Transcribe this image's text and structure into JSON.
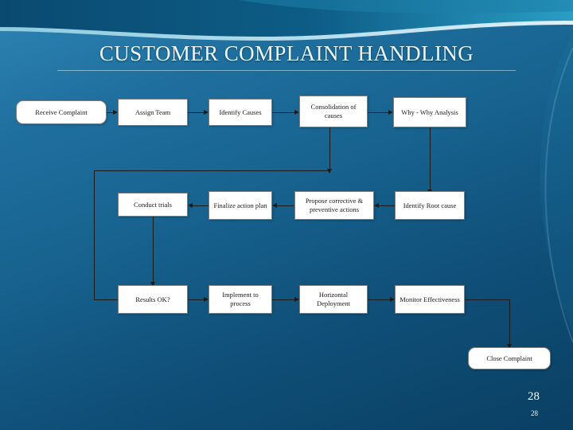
{
  "slide": {
    "title": "CUSTOMER COMPLAINT HANDLING",
    "page_number": "28",
    "page_number_small": "28",
    "colors": {
      "background_top": "#2e85b4",
      "background_bottom": "#0a3f63",
      "node_fill": "#ffffff",
      "node_border": "#7e7e7e",
      "connector": "#1b1b1b",
      "title_text": "#eaf6fb"
    }
  },
  "diagram": {
    "type": "flowchart",
    "nodes": [
      {
        "id": "receive-complaint",
        "label": "Receive Complaint",
        "shape": "rounded",
        "row": 1,
        "col": 1
      },
      {
        "id": "assign-team",
        "label": "Assign Team",
        "shape": "rect",
        "row": 1,
        "col": 2
      },
      {
        "id": "identify-causes",
        "label": "Identify Causes",
        "shape": "rect",
        "row": 1,
        "col": 3
      },
      {
        "id": "consolidation-of-causes",
        "label": "Consolidation of causes",
        "shape": "rect",
        "row": 1,
        "col": 4
      },
      {
        "id": "why-why-analysis",
        "label": "Why - Why Analysis",
        "shape": "rect",
        "row": 1,
        "col": 5
      },
      {
        "id": "conduct-trials",
        "label": "Conduct trials",
        "shape": "rect",
        "row": 2,
        "col": 2
      },
      {
        "id": "finalize-action-plan",
        "label": "Finalize action plan",
        "shape": "rect",
        "row": 2,
        "col": 3
      },
      {
        "id": "propose-corrective-preventive-actions",
        "label": "Propose corrective & preventive actions",
        "shape": "rect",
        "row": 2,
        "col": 4
      },
      {
        "id": "identify-root-cause",
        "label": "Identify Root cause",
        "shape": "rect",
        "row": 2,
        "col": 5
      },
      {
        "id": "results-ok",
        "label": "Results OK?",
        "shape": "rect",
        "row": 3,
        "col": 2
      },
      {
        "id": "implement-to-process",
        "label": "Implement to process",
        "shape": "rect",
        "row": 3,
        "col": 3
      },
      {
        "id": "horizontal-deployment",
        "label": "Horizontal Deployment",
        "shape": "rect",
        "row": 3,
        "col": 4
      },
      {
        "id": "monitor-effectiveness",
        "label": "Monitor Effectiveness",
        "shape": "rect",
        "row": 3,
        "col": 5
      },
      {
        "id": "close-complaint",
        "label": "Close Complaint",
        "shape": "rounded",
        "row": 4,
        "col": 5
      }
    ],
    "edges": [
      {
        "from": "receive-complaint",
        "to": "assign-team"
      },
      {
        "from": "assign-team",
        "to": "identify-causes"
      },
      {
        "from": "identify-causes",
        "to": "consolidation-of-causes"
      },
      {
        "from": "consolidation-of-causes",
        "to": "why-why-analysis"
      },
      {
        "from": "why-why-analysis",
        "to": "identify-root-cause"
      },
      {
        "from": "identify-root-cause",
        "to": "propose-corrective-preventive-actions"
      },
      {
        "from": "propose-corrective-preventive-actions",
        "to": "finalize-action-plan"
      },
      {
        "from": "finalize-action-plan",
        "to": "conduct-trials"
      },
      {
        "from": "conduct-trials",
        "to": "results-ok"
      },
      {
        "from": "results-ok",
        "to": "implement-to-process"
      },
      {
        "from": "implement-to-process",
        "to": "horizontal-deployment"
      },
      {
        "from": "horizontal-deployment",
        "to": "monitor-effectiveness"
      },
      {
        "from": "monitor-effectiveness",
        "to": "close-complaint"
      },
      {
        "from": "results-ok",
        "to": "assign-team",
        "note": "loop back"
      }
    ]
  }
}
